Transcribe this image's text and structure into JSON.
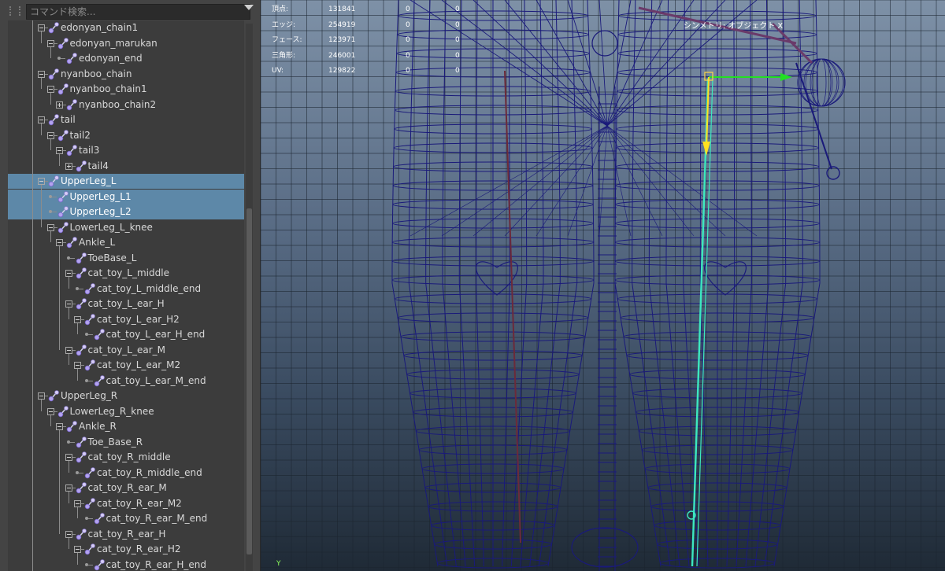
{
  "outliner": {
    "search_placeholder": "コマンド検索...",
    "rows": [
      {
        "label": "edonyan_chain1",
        "depth": 3,
        "toggle": "minus",
        "selected": false
      },
      {
        "label": "edonyan_marukan",
        "depth": 4,
        "toggle": "minus",
        "selected": false
      },
      {
        "label": "edonyan_end",
        "depth": 5,
        "toggle": "none",
        "selected": false
      },
      {
        "label": "nyanboo_chain",
        "depth": 3,
        "toggle": "minus",
        "selected": false
      },
      {
        "label": "nyanboo_chain1",
        "depth": 4,
        "toggle": "minus",
        "selected": false
      },
      {
        "label": "nyanboo_chain2",
        "depth": 5,
        "toggle": "plus",
        "selected": false
      },
      {
        "label": "tail",
        "depth": 3,
        "toggle": "minus",
        "selected": false
      },
      {
        "label": "tail2",
        "depth": 4,
        "toggle": "minus",
        "selected": false
      },
      {
        "label": "tail3",
        "depth": 5,
        "toggle": "minus",
        "selected": false
      },
      {
        "label": "tail4",
        "depth": 6,
        "toggle": "plus",
        "selected": false
      },
      {
        "label": "UpperLeg_L",
        "depth": 3,
        "toggle": "minus",
        "selected": true
      },
      {
        "label": "UpperLeg_L1",
        "depth": 4,
        "toggle": "none",
        "selected": true
      },
      {
        "label": "UpperLeg_L2",
        "depth": 4,
        "toggle": "none",
        "selected": true
      },
      {
        "label": "LowerLeg_L_knee",
        "depth": 4,
        "toggle": "minus",
        "selected": false
      },
      {
        "label": "Ankle_L",
        "depth": 5,
        "toggle": "minus",
        "selected": false
      },
      {
        "label": "ToeBase_L",
        "depth": 6,
        "toggle": "none",
        "selected": false
      },
      {
        "label": "cat_toy_L_middle",
        "depth": 6,
        "toggle": "minus",
        "selected": false
      },
      {
        "label": "cat_toy_L_middle_end",
        "depth": 7,
        "toggle": "none",
        "selected": false
      },
      {
        "label": "cat_toy_L_ear_H",
        "depth": 6,
        "toggle": "minus",
        "selected": false
      },
      {
        "label": "cat_toy_L_ear_H2",
        "depth": 7,
        "toggle": "minus",
        "selected": false
      },
      {
        "label": "cat_toy_L_ear_H_end",
        "depth": 8,
        "toggle": "none",
        "selected": false
      },
      {
        "label": "cat_toy_L_ear_M",
        "depth": 6,
        "toggle": "minus",
        "selected": false
      },
      {
        "label": "cat_toy_L_ear_M2",
        "depth": 7,
        "toggle": "minus",
        "selected": false
      },
      {
        "label": "cat_toy_L_ear_M_end",
        "depth": 8,
        "toggle": "none",
        "selected": false
      },
      {
        "label": "UpperLeg_R",
        "depth": 3,
        "toggle": "minus",
        "selected": false
      },
      {
        "label": "LowerLeg_R_knee",
        "depth": 4,
        "toggle": "minus",
        "selected": false
      },
      {
        "label": "Ankle_R",
        "depth": 5,
        "toggle": "minus",
        "selected": false
      },
      {
        "label": "Toe_Base_R",
        "depth": 6,
        "toggle": "none",
        "selected": false
      },
      {
        "label": "cat_toy_R_middle",
        "depth": 6,
        "toggle": "minus",
        "selected": false
      },
      {
        "label": "cat_toy_R_middle_end",
        "depth": 7,
        "toggle": "none",
        "selected": false
      },
      {
        "label": "cat_toy_R_ear_M",
        "depth": 6,
        "toggle": "minus",
        "selected": false
      },
      {
        "label": "cat_toy_R_ear_M2",
        "depth": 7,
        "toggle": "minus",
        "selected": false
      },
      {
        "label": "cat_toy_R_ear_M_end",
        "depth": 8,
        "toggle": "none",
        "selected": false
      },
      {
        "label": "cat_toy_R_ear_H",
        "depth": 6,
        "toggle": "minus",
        "selected": false
      },
      {
        "label": "cat_toy_R_ear_H2",
        "depth": 7,
        "toggle": "minus",
        "selected": false
      },
      {
        "label": "cat_toy_R_ear_H_end",
        "depth": 8,
        "toggle": "none",
        "selected": false
      }
    ]
  },
  "hud": {
    "rows": [
      {
        "label": "頂点:",
        "value": "131841",
        "selected": "0",
        "triangles": "0"
      },
      {
        "label": "エッジ:",
        "value": "254919",
        "selected": "0",
        "triangles": "0"
      },
      {
        "label": "フェース:",
        "value": "123971",
        "selected": "0",
        "triangles": "0"
      },
      {
        "label": "三角形:",
        "value": "246001",
        "selected": "0",
        "triangles": "0"
      },
      {
        "label": "UV:",
        "value": "129822",
        "selected": "0",
        "triangles": "0"
      }
    ],
    "symmetry_label": "シンメトリ: オブジェクト X"
  },
  "axis_label": "Y",
  "colors": {
    "selection": "#5d88a8",
    "wire": "#1a1a7a",
    "joint": "#6b5cc8",
    "bone_highlight": "#3ce8c0",
    "manip_y": "#ffe020",
    "manip_x": "#22e022"
  }
}
